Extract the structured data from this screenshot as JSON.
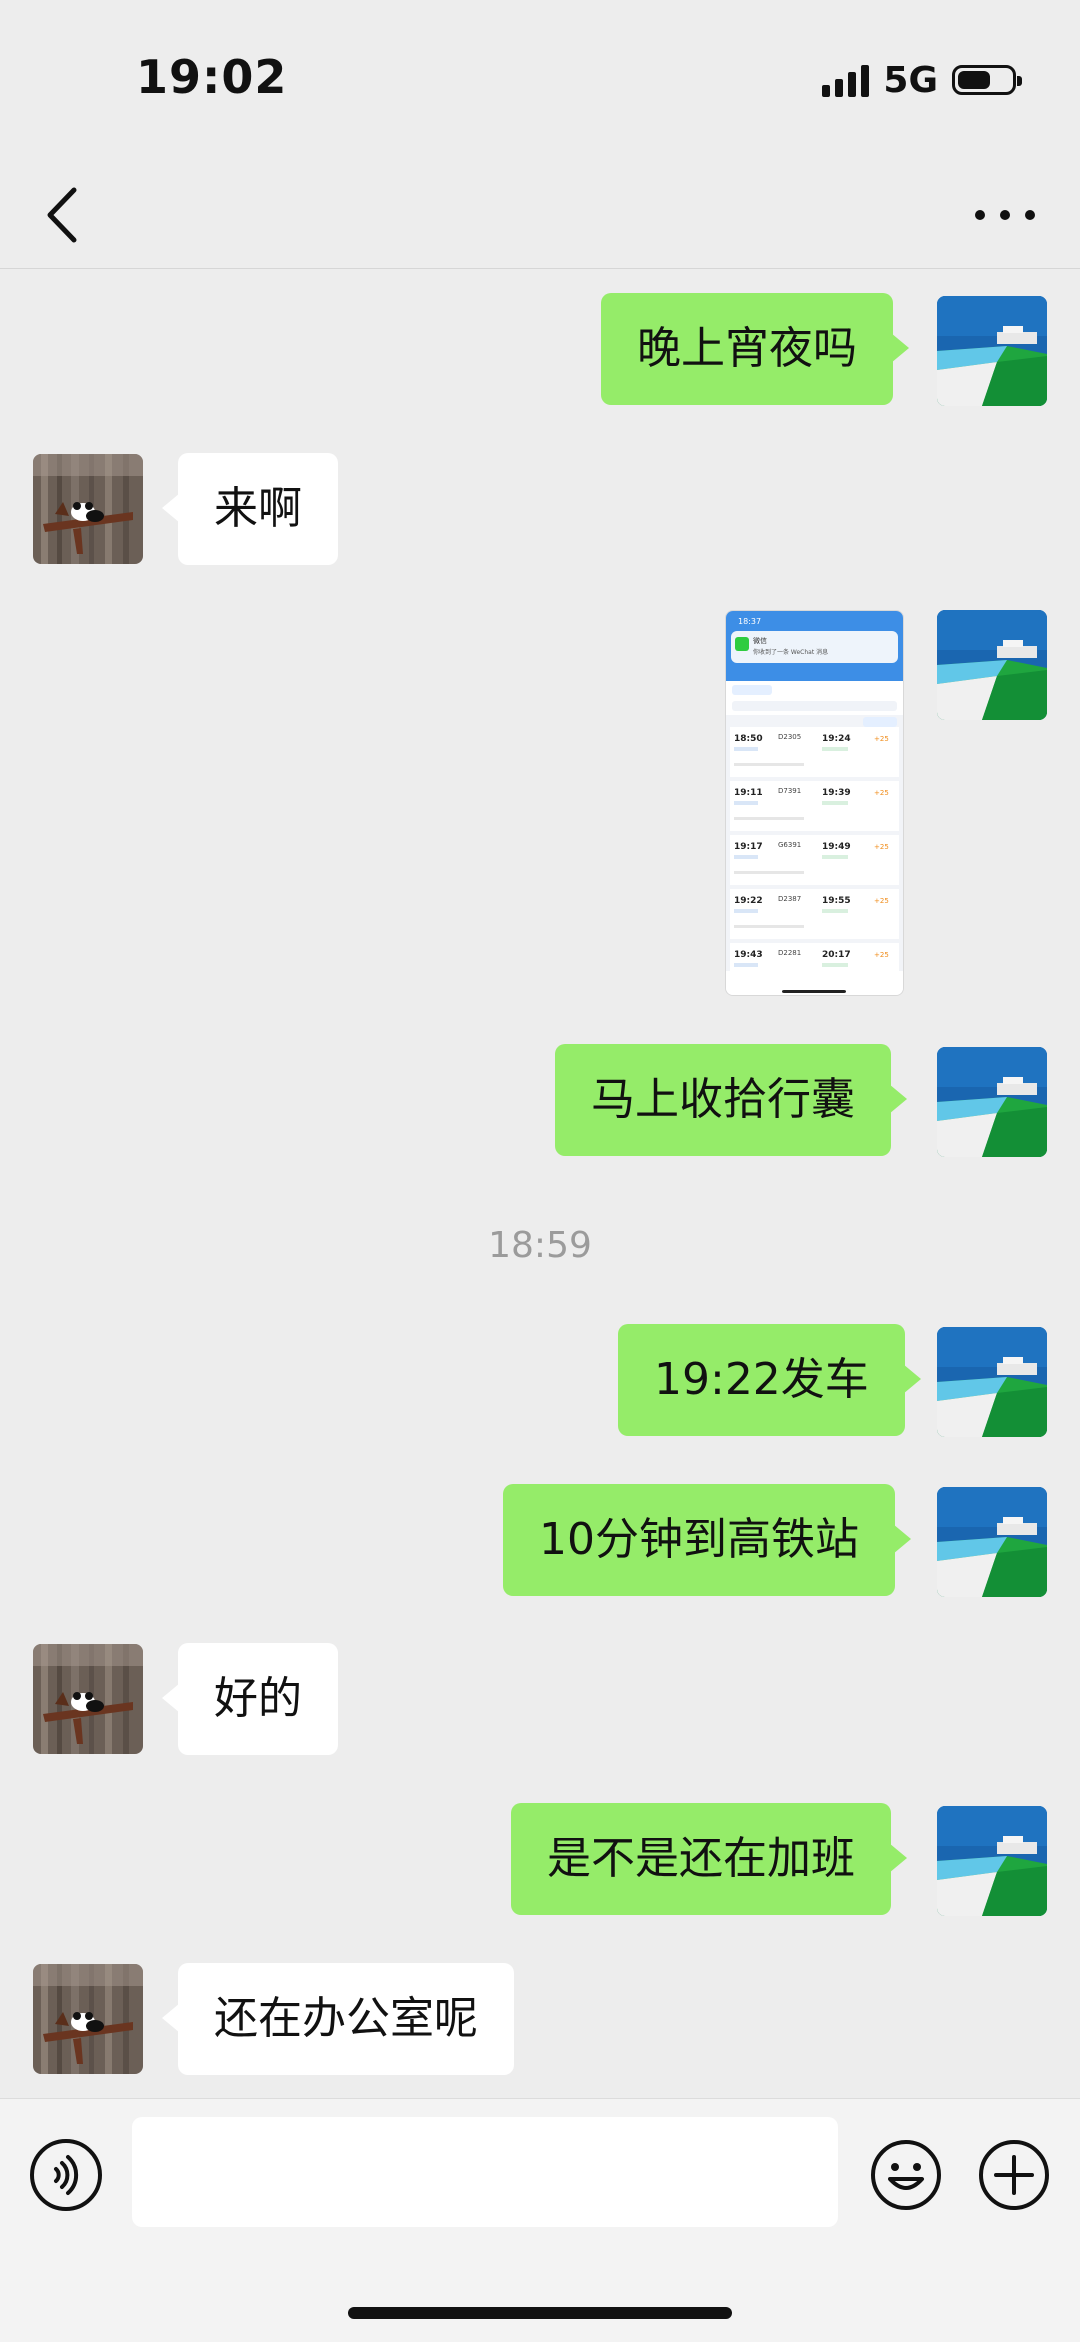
{
  "status_bar": {
    "time": "19:02",
    "network": "5G"
  },
  "nav": {
    "back_icon": "chevron-left-icon",
    "more_icon": "more-dots-icon"
  },
  "messages": [
    {
      "id": "m1",
      "side": "out",
      "type": "text",
      "text": "晚上宵夜吗"
    },
    {
      "id": "m2",
      "side": "in",
      "type": "text",
      "text": "来啊"
    },
    {
      "id": "m3",
      "side": "out",
      "type": "image"
    },
    {
      "id": "m4",
      "side": "out",
      "type": "text",
      "text": "马上收拾行囊"
    },
    {
      "id": "ts",
      "type": "timestamp",
      "text": "18:59"
    },
    {
      "id": "m5",
      "side": "out",
      "type": "text",
      "text": "19:22发车"
    },
    {
      "id": "m6",
      "side": "out",
      "type": "text",
      "text": "10分钟到高铁站"
    },
    {
      "id": "m7",
      "side": "in",
      "type": "text",
      "text": "好的"
    },
    {
      "id": "m8",
      "side": "out",
      "type": "text",
      "text": "是不是还在加班"
    },
    {
      "id": "m9",
      "side": "in",
      "type": "text",
      "text": "还在办公室呢"
    }
  ],
  "screenshot": {
    "status_time": "18:37",
    "notification_title": "微信",
    "notification_body": "你收到了一条 WeChat 消息",
    "trains": [
      {
        "depart": "18:50",
        "train": "D2305",
        "arrive": "19:24",
        "price": "+25"
      },
      {
        "depart": "19:11",
        "train": "D7391",
        "arrive": "19:39",
        "price": "+25"
      },
      {
        "depart": "19:17",
        "train": "G6391",
        "arrive": "19:49",
        "price": "+25"
      },
      {
        "depart": "19:22",
        "train": "D2387",
        "arrive": "19:55",
        "price": "+25"
      },
      {
        "depart": "19:43",
        "train": "D2281",
        "arrive": "20:17",
        "price": "+25"
      }
    ]
  },
  "input_bar": {
    "placeholder": ""
  },
  "colors": {
    "outgoing_bubble": "#95ec69",
    "incoming_bubble": "#ffffff",
    "background": "#ededed"
  }
}
